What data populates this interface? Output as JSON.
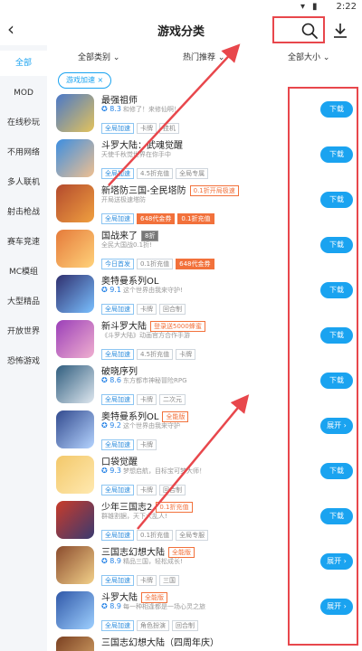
{
  "status": {
    "time": "2:22"
  },
  "header": {
    "title": "游戏分类",
    "back_icon": "back-icon",
    "search_icon": "search-icon",
    "download_icon": "download-icon"
  },
  "sidebar": {
    "items": [
      "全部",
      "MOD",
      "在线秒玩",
      "不用网络",
      "多人联机",
      "射击枪战",
      "赛车竞速",
      "MC模组",
      "大型精品",
      "开放世界",
      "恐怖游戏"
    ]
  },
  "filters": [
    "全部类别 ⌄",
    "热门推荐 ⌄",
    "全部大小 ⌄"
  ],
  "tagline": "游戏加速 ×",
  "games": [
    {
      "name": "最强祖师",
      "rating": "8.3",
      "desc": "和修了！来修仙啊！",
      "tags": [
        "全局加速",
        "卡牌",
        "挂机"
      ],
      "action": "下载",
      "colors": [
        "#4a78c8",
        "#e4c35b"
      ]
    },
    {
      "name": "斗罗大陆：武魂觉醒",
      "rating": "",
      "desc": "天使千秋觉世界在你手中",
      "tags": [
        "全局加速",
        "4.5折充值",
        "全局专属"
      ],
      "action": "下载",
      "colors": [
        "#3d8ee0",
        "#f0c090"
      ]
    },
    {
      "name": "新塔防三国-全民塔防",
      "badge": "0.1折开局极速",
      "rating": "",
      "desc": "开局送极速塔防",
      "tags": [
        "全局加速",
        "648代金券",
        "0.1折充值"
      ],
      "orange": [
        1,
        2
      ],
      "action": "下载",
      "colors": [
        "#b34a2d",
        "#f0a040"
      ]
    },
    {
      "name": "国战来了",
      "badge2": "8折",
      "rating": "",
      "desc": "全民大国战0.1折!",
      "tags": [
        "今日首发",
        "0.1折充值",
        "648代金券"
      ],
      "orange": [
        2
      ],
      "action": "下载",
      "colors": [
        "#e57a3a",
        "#ffd27a"
      ]
    },
    {
      "name": "奥特曼系列OL",
      "rating": "9.1",
      "desc": "这个世界由我来守护!",
      "tags": [
        "全局加速",
        "卡牌",
        "回合制"
      ],
      "action": "下载",
      "colors": [
        "#2f2f6e",
        "#7ac0ff"
      ]
    },
    {
      "name": "新斗罗大陆",
      "badge": "登录送5000蜂蜜",
      "rating": "",
      "desc": "《斗罗大陆》动画官方合作手游",
      "tags": [
        "全局加速",
        "4.5折充值",
        "卡牌"
      ],
      "action": "下载",
      "colors": [
        "#9b3fb8",
        "#f0b0d0"
      ]
    },
    {
      "name": "破晓序列",
      "rating": "8.6",
      "desc": "东方都市神秘冒险RPG",
      "tags": [
        "全局加速",
        "卡牌",
        "二次元"
      ],
      "action": "下载",
      "colors": [
        "#2f5d7e",
        "#dfe8f0"
      ]
    },
    {
      "name": "奥特曼系列OL",
      "badge": "全能版",
      "rating": "9.2",
      "desc": "这个世界由我来守护",
      "tags": [
        "全局加速",
        "卡牌"
      ],
      "action": "展开 ›",
      "colors": [
        "#324a8e",
        "#b5d4ff"
      ]
    },
    {
      "name": "口袋觉醒",
      "rating": "9.3",
      "desc": "梦想启航，目标宝可梦大师！",
      "tags": [
        "全局加速",
        "卡牌",
        "回合制"
      ],
      "action": "下载",
      "colors": [
        "#f3c86a",
        "#ffe9b0"
      ]
    },
    {
      "name": "少年三国志2",
      "badge": "0.1折充值",
      "rating": "",
      "desc": "群雄割据，天下大乱人!",
      "tags": [
        "全局加速",
        "0.1折充值",
        "全局专服"
      ],
      "action": "下载",
      "colors": [
        "#c93b2a",
        "#3a3a70"
      ]
    },
    {
      "name": "三国志幻想大陆",
      "badge": "全能版",
      "rating": "8.9",
      "desc": "精品三国，轻松成长!",
      "tags": [
        "全局加速",
        "卡牌",
        "三国"
      ],
      "action": "展开 ›",
      "colors": [
        "#8a4b2d",
        "#f3d18a"
      ]
    },
    {
      "name": "斗罗大陆",
      "badge": "全能版",
      "rating": "8.9",
      "desc": "每一种相逢都是一场心灵之旅",
      "tags": [
        "全局加速",
        "角色扮演",
        "回合制"
      ],
      "action": "展开 ›",
      "colors": [
        "#3058a8",
        "#9ed0ff"
      ]
    },
    {
      "name": "三国志幻想大陆（四周年庆）",
      "rating": "",
      "desc": "",
      "tags": [],
      "action": "",
      "colors": [
        "#7a4022",
        "#e0b070"
      ]
    }
  ]
}
